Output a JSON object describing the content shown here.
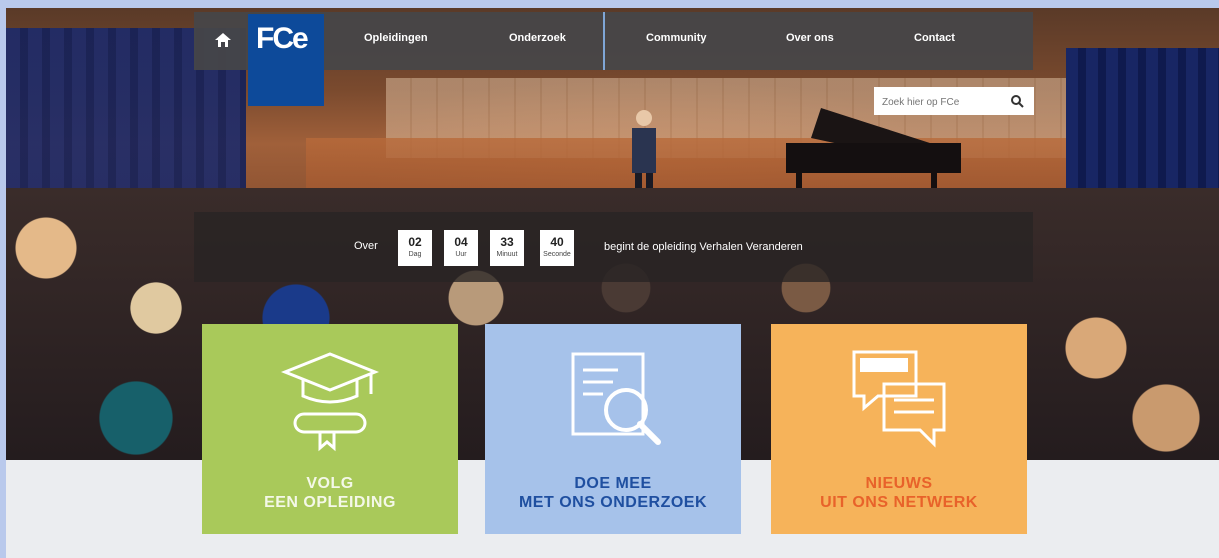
{
  "nav": {
    "logo_text": "FCe",
    "logo_sub": "",
    "items": [
      {
        "label": "Opleidingen"
      },
      {
        "label": "Onderzoek"
      },
      {
        "label": "Community"
      },
      {
        "label": "Over ons"
      },
      {
        "label": "Contact"
      }
    ]
  },
  "search": {
    "placeholder": "Zoek hier op FCe"
  },
  "hero_news": {
    "line1": "",
    "line2": ""
  },
  "countdown": {
    "prefix": "Over",
    "units": [
      {
        "value": "02",
        "unit": "Dag"
      },
      {
        "value": "04",
        "unit": "Uur"
      },
      {
        "value": "33",
        "unit": "Minuut"
      },
      {
        "value": "40",
        "unit": "Seconde"
      }
    ],
    "text": "begint de opleiding Verhalen Veranderen"
  },
  "tiles": [
    {
      "line1": "VOLG",
      "line2": "EEN OPLEIDING",
      "icon": "graduation-icon",
      "color": "#a9c95a"
    },
    {
      "line1": "DOE MEE",
      "line2": "MET ONS ONDERZOEK",
      "icon": "research-icon",
      "color": "#a6c2ea"
    },
    {
      "line1": "NIEUWS",
      "line2": "UIT ONS NETWERK",
      "icon": "news-icon",
      "color": "#f6b35a"
    }
  ],
  "icons": {
    "home": "home-icon",
    "search": "search-icon"
  }
}
